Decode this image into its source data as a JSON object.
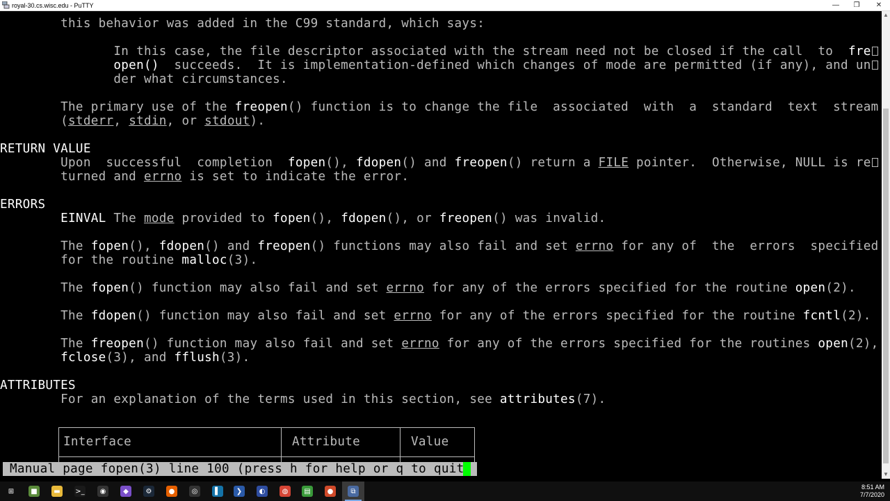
{
  "window": {
    "title": "royal-30.cs.wisc.edu - PuTTY",
    "minimize": "—",
    "maximize": "❐",
    "close": "✕"
  },
  "terminal": {
    "lines": [
      [
        "        ",
        [
          "this behavior was added in the C99 standard, which says:",
          ""
        ]
      ],
      [],
      [
        "               ",
        [
          "In this case, the file descriptor associated with the stream need not be closed if the call  to  ",
          ""
        ],
        [
          "fre",
          "b"
        ],
        [
          "",
          "glyph"
        ]
      ],
      [
        "               ",
        [
          "open()",
          "b"
        ],
        [
          "  succeeds.  It is implementation-defined which changes of mode are permitted (if any), and un",
          ""
        ],
        [
          "",
          "glyph"
        ]
      ],
      [
        "               ",
        [
          "der what circumstances.",
          ""
        ]
      ],
      [],
      [
        "        ",
        [
          "The primary use of the ",
          ""
        ],
        [
          "freopen",
          "b"
        ],
        [
          "() function is to change the file  associated  with  a  standard  text  stream",
          ""
        ]
      ],
      [
        "        ",
        [
          "(",
          ""
        ],
        [
          "stderr",
          "u"
        ],
        [
          ", ",
          ""
        ],
        [
          "stdin",
          "u"
        ],
        [
          ", or ",
          ""
        ],
        [
          "stdout",
          "u"
        ],
        [
          ").",
          ""
        ]
      ],
      [],
      [
        "",
        [
          "RETURN VALUE",
          "b"
        ]
      ],
      [
        "        ",
        [
          "Upon  successful  completion  ",
          ""
        ],
        [
          "fopen",
          "b"
        ],
        [
          "(), ",
          ""
        ],
        [
          "fdopen",
          "b"
        ],
        [
          "() and ",
          ""
        ],
        [
          "freopen",
          "b"
        ],
        [
          "() return a ",
          ""
        ],
        [
          "FILE",
          "u"
        ],
        [
          " pointer.  Otherwise, NULL is re",
          ""
        ],
        [
          "",
          "glyph"
        ]
      ],
      [
        "        ",
        [
          "turned and ",
          ""
        ],
        [
          "errno",
          "u"
        ],
        [
          " is set to indicate the error.",
          ""
        ]
      ],
      [],
      [
        "",
        [
          "ERRORS",
          "b"
        ]
      ],
      [
        "        ",
        [
          "EINVAL",
          "b"
        ],
        [
          " The ",
          ""
        ],
        [
          "mode",
          "u"
        ],
        [
          " provided to ",
          ""
        ],
        [
          "fopen",
          "b"
        ],
        [
          "(), ",
          ""
        ],
        [
          "fdopen",
          "b"
        ],
        [
          "(), or ",
          ""
        ],
        [
          "freopen",
          "b"
        ],
        [
          "() was invalid.",
          ""
        ]
      ],
      [],
      [
        "        ",
        [
          "The ",
          ""
        ],
        [
          "fopen",
          "b"
        ],
        [
          "(), ",
          ""
        ],
        [
          "fdopen",
          "b"
        ],
        [
          "() and ",
          ""
        ],
        [
          "freopen",
          "b"
        ],
        [
          "() functions may also fail and set ",
          ""
        ],
        [
          "errno",
          "u"
        ],
        [
          " for any of  the  errors  specified",
          ""
        ]
      ],
      [
        "        ",
        [
          "for the routine ",
          ""
        ],
        [
          "malloc",
          "b"
        ],
        [
          "(3).",
          ""
        ]
      ],
      [],
      [
        "        ",
        [
          "The ",
          ""
        ],
        [
          "fopen",
          "b"
        ],
        [
          "() function may also fail and set ",
          ""
        ],
        [
          "errno",
          "u"
        ],
        [
          " for any of the errors specified for the routine ",
          ""
        ],
        [
          "open",
          "b"
        ],
        [
          "(2).",
          ""
        ]
      ],
      [],
      [
        "        ",
        [
          "The ",
          ""
        ],
        [
          "fdopen",
          "b"
        ],
        [
          "() function may also fail and set ",
          ""
        ],
        [
          "errno",
          "u"
        ],
        [
          " for any of the errors specified for the routine ",
          ""
        ],
        [
          "fcntl",
          "b"
        ],
        [
          "(2).",
          ""
        ]
      ],
      [],
      [
        "        ",
        [
          "The ",
          ""
        ],
        [
          "freopen",
          "b"
        ],
        [
          "() function may also fail and set ",
          ""
        ],
        [
          "errno",
          "u"
        ],
        [
          " for any of the errors specified for the routines ",
          ""
        ],
        [
          "open",
          "b"
        ],
        [
          "(2),",
          ""
        ]
      ],
      [
        "        ",
        [
          "fclose",
          "b"
        ],
        [
          "(3), and ",
          ""
        ],
        [
          "fflush",
          "b"
        ],
        [
          "(3).",
          ""
        ]
      ],
      [],
      [
        "",
        [
          "ATTRIBUTES",
          "b"
        ]
      ],
      [
        "        ",
        [
          "For an explanation of the terms used in this section, see ",
          ""
        ],
        [
          "attributes",
          "b"
        ],
        [
          "(7).",
          ""
        ]
      ]
    ],
    "table_headers": [
      "Interface",
      "Attribute",
      "Value"
    ],
    "status_line": "Manual page fopen(3) line 100 (press h for help or q to quit)"
  },
  "taskbar": {
    "items": [
      {
        "name": "start-button",
        "icon": "windows-logo-icon",
        "glyph": "⊞",
        "color": "#101010"
      },
      {
        "name": "taskbar-minecraft",
        "icon": "minecraft-icon",
        "glyph": "■",
        "color": "#5a8a3a"
      },
      {
        "name": "taskbar-file-explorer",
        "icon": "folder-icon",
        "glyph": "▬",
        "color": "#e8b93a"
      },
      {
        "name": "taskbar-terminal",
        "icon": "terminal-icon",
        "glyph": ">_",
        "color": "#1a1a1a"
      },
      {
        "name": "taskbar-app-oval",
        "icon": "oval-app-icon",
        "glyph": "◉",
        "color": "#333333"
      },
      {
        "name": "taskbar-visual-studio",
        "icon": "visual-studio-icon",
        "glyph": "◆",
        "color": "#7a4fc9"
      },
      {
        "name": "taskbar-steam",
        "icon": "steam-icon",
        "glyph": "⚙",
        "color": "#1b2838"
      },
      {
        "name": "taskbar-firefox",
        "icon": "firefox-icon",
        "glyph": "●",
        "color": "#e66000"
      },
      {
        "name": "taskbar-github",
        "icon": "github-icon",
        "glyph": "◎",
        "color": "#333333"
      },
      {
        "name": "taskbar-book-app",
        "icon": "book-icon",
        "glyph": "▌",
        "color": "#1473a8"
      },
      {
        "name": "taskbar-powershell",
        "icon": "powershell-icon",
        "glyph": "❯",
        "color": "#2a5aa8"
      },
      {
        "name": "taskbar-bluetooth-app",
        "icon": "bluetooth-app-icon",
        "glyph": "◐",
        "color": "#2e4da0"
      },
      {
        "name": "taskbar-chrome",
        "icon": "chrome-icon",
        "glyph": "◍",
        "color": "#d64535"
      },
      {
        "name": "taskbar-notepad",
        "icon": "notepad-icon",
        "glyph": "▤",
        "color": "#3a9a3a"
      },
      {
        "name": "taskbar-powerpoint",
        "icon": "powerpoint-icon",
        "glyph": "●",
        "color": "#d04a2a"
      },
      {
        "name": "taskbar-putty",
        "icon": "putty-icon",
        "glyph": "⧉",
        "color": "#4a6aa0",
        "active": true
      }
    ],
    "time": "8:51 AM",
    "date": "7/7/2020"
  }
}
